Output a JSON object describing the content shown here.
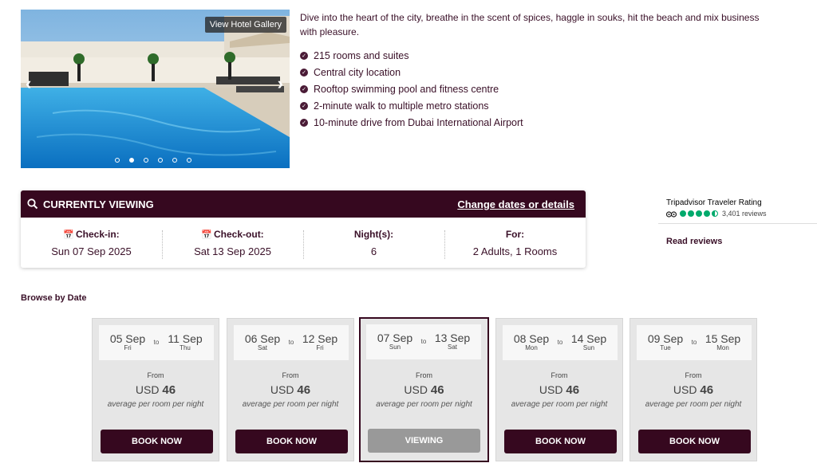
{
  "gallery": {
    "button_label": "View Hotel Gallery",
    "slide_count": 6,
    "active_slide": 2
  },
  "hotel": {
    "description": "Dive into the heart of the city, breathe in the scent of spices, haggle in souks, hit the beach and mix business with pleasure.",
    "features": [
      "215 rooms and suites",
      "Central city location",
      "Rooftop swimming pool and fitness centre",
      "2-minute walk to multiple metro stations",
      "10-minute drive from Dubai International Airport"
    ]
  },
  "viewing": {
    "title": "CURRENTLY VIEWING",
    "change_link": "Change dates or details",
    "checkin_label": "Check-in:",
    "checkin_value": "Sun 07 Sep 2025",
    "checkout_label": "Check-out:",
    "checkout_value": "Sat 13 Sep 2025",
    "nights_label": "Night(s):",
    "nights_value": "6",
    "for_label": "For:",
    "for_value": "2 Adults, 1 Rooms"
  },
  "tripadvisor": {
    "title": "Tripadvisor Traveler Rating",
    "rating": 4.5,
    "reviews": "3,401 reviews",
    "read_reviews": "Read reviews"
  },
  "browse": {
    "title": "Browse by Date",
    "cards": [
      {
        "from_date": "05 Sep",
        "from_day": "Fri",
        "to": "to",
        "to_date": "11 Sep",
        "to_day": "Thu",
        "from_label": "From",
        "currency": "USD",
        "amount": "46",
        "per_night": "average per room per night",
        "button": "BOOK NOW",
        "current": false
      },
      {
        "from_date": "06 Sep",
        "from_day": "Sat",
        "to": "to",
        "to_date": "12 Sep",
        "to_day": "Fri",
        "from_label": "From",
        "currency": "USD",
        "amount": "46",
        "per_night": "average per room per night",
        "button": "BOOK NOW",
        "current": false
      },
      {
        "from_date": "07 Sep",
        "from_day": "Sun",
        "to": "to",
        "to_date": "13 Sep",
        "to_day": "Sat",
        "from_label": "From",
        "currency": "USD",
        "amount": "46",
        "per_night": "average per room per night",
        "button": "VIEWING",
        "current": true
      },
      {
        "from_date": "08 Sep",
        "from_day": "Mon",
        "to": "to",
        "to_date": "14 Sep",
        "to_day": "Sun",
        "from_label": "From",
        "currency": "USD",
        "amount": "46",
        "per_night": "average per room per night",
        "button": "BOOK NOW",
        "current": false
      },
      {
        "from_date": "09 Sep",
        "from_day": "Tue",
        "to": "to",
        "to_date": "15 Sep",
        "to_day": "Mon",
        "from_label": "From",
        "currency": "USD",
        "amount": "46",
        "per_night": "average per room per night",
        "button": "BOOK NOW",
        "current": false
      }
    ]
  }
}
